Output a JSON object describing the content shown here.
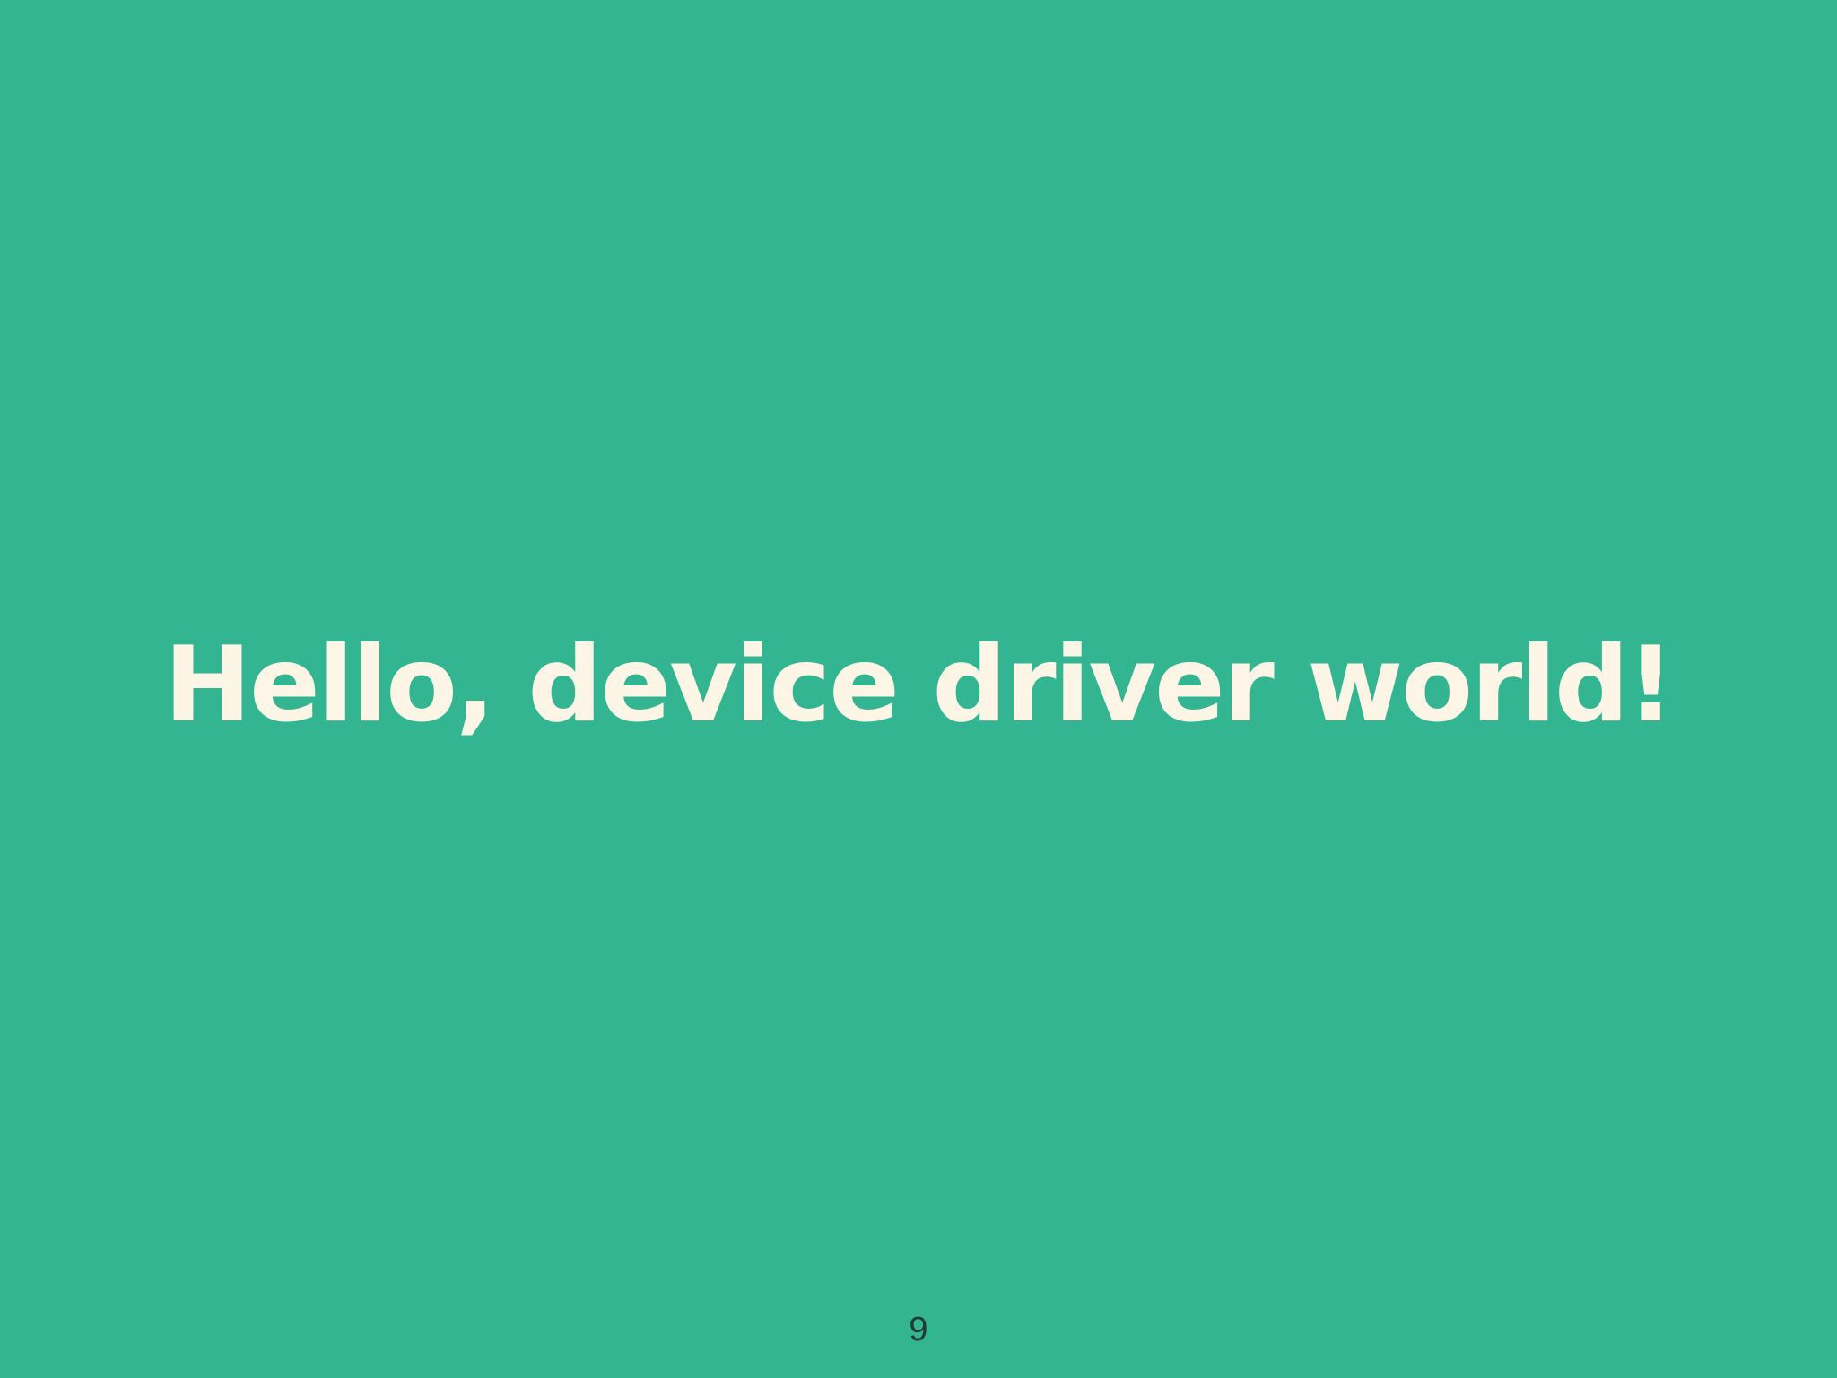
{
  "slide": {
    "title": "Hello, device driver world!",
    "page_number": "9"
  },
  "colors": {
    "background": "#33b592",
    "title_text": "#fdf6e6",
    "page_number_text": "#1f3a33"
  }
}
